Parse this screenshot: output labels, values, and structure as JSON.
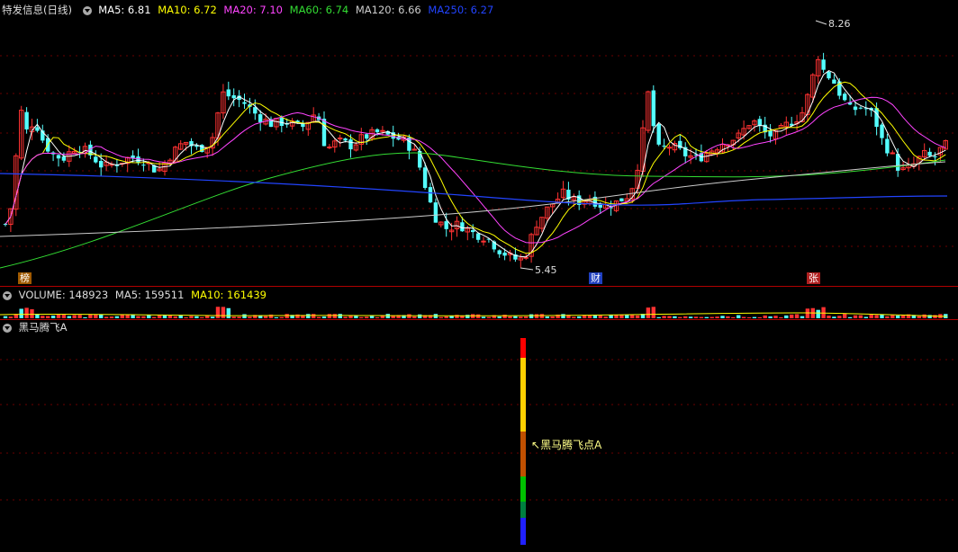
{
  "price_panel": {
    "title": "特发信息(日线)",
    "ma": [
      {
        "label": "MA5: 6.81",
        "color": "#ffffff"
      },
      {
        "label": "MA10: 6.72",
        "color": "#ffff00"
      },
      {
        "label": "MA20: 7.10",
        "color": "#ff44ff"
      },
      {
        "label": "MA60: 6.74",
        "color": "#33dd33"
      },
      {
        "label": "MA120: 6.66",
        "color": "#cccccc"
      },
      {
        "label": "MA250: 6.27",
        "color": "#2244ff"
      }
    ],
    "high_label": "8.26",
    "low_label": "5.45",
    "tags": {
      "bang": "榜",
      "cai": "财",
      "zhang": "张"
    }
  },
  "volume_panel": {
    "items": [
      {
        "label": "VOLUME: 148923",
        "color": "#dddddd"
      },
      {
        "label": "MA5: 159511",
        "color": "#dddddd"
      },
      {
        "label": "MA10: 161439",
        "color": "#ffff00"
      }
    ]
  },
  "indicator_panel": {
    "title": "黑马腾飞A",
    "signal_label": "黑马腾飞点A"
  },
  "colors": {
    "up": "#ff3232",
    "down": "#54ffff",
    "grid": "#6a0000",
    "divider": "#b00000"
  },
  "chart_data": [
    {
      "type": "candlestick",
      "title": "特发信息(日线)",
      "annotations": {
        "high": 8.26,
        "low": 5.45
      },
      "series": [
        {
          "name": "MA5",
          "value": 6.81
        },
        {
          "name": "MA10",
          "value": 6.72
        },
        {
          "name": "MA20",
          "value": 7.1
        },
        {
          "name": "MA60",
          "value": 6.74
        },
        {
          "name": "MA120",
          "value": 6.66
        },
        {
          "name": "MA250",
          "value": 6.27
        }
      ]
    },
    {
      "type": "bar",
      "series": [
        {
          "name": "VOLUME",
          "value": 148923
        },
        {
          "name": "MA5",
          "value": 159511
        },
        {
          "name": "MA10",
          "value": 161439
        }
      ]
    }
  ]
}
